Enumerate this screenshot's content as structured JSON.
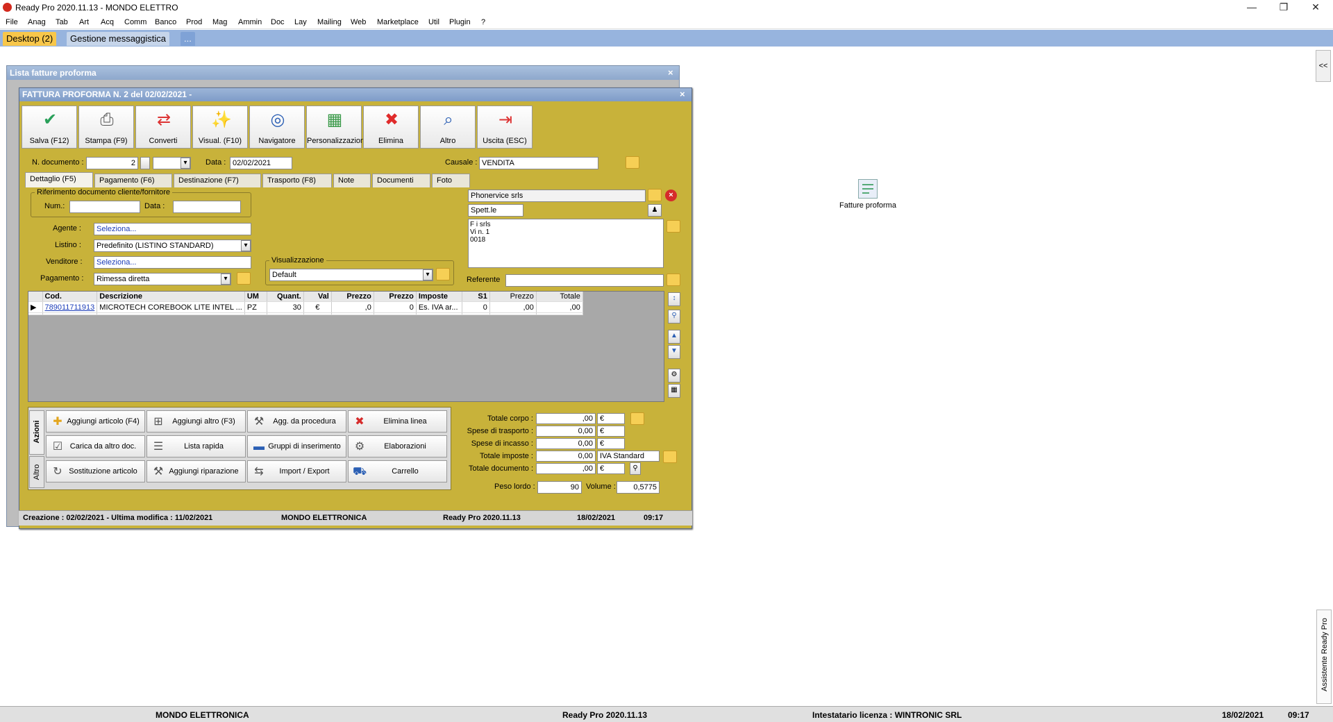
{
  "app": {
    "title": "Ready Pro 2020.11.13 - MONDO ELETTRO"
  },
  "menu": [
    "File",
    "Anag",
    "Tab",
    "Art",
    "Acq",
    "Comm",
    "Banco",
    "Prod",
    "Mag",
    "Ammin",
    "Doc",
    "Lay",
    "Mailing",
    "Web",
    "Marketplace",
    "Util",
    "Plugin",
    "?"
  ],
  "tabs": [
    "Desktop (2)",
    "Gestione messaggistica",
    "..."
  ],
  "outer_window": {
    "title": "Lista fatture proforma"
  },
  "window": {
    "title": "FATTURA PROFORMA N. 2 del 02/02/2021 -"
  },
  "toolbar": [
    {
      "label": "Salva (F12)",
      "icon": "check-icon",
      "color": "#2aa05a"
    },
    {
      "label": "Stampa (F9)",
      "icon": "printer-icon",
      "color": "#555"
    },
    {
      "label": "Converti",
      "icon": "convert-icon",
      "color": "#d33"
    },
    {
      "label": "Visual. (F10)",
      "icon": "wand-icon",
      "color": "#e39b1c"
    },
    {
      "label": "Navigatore",
      "icon": "compass-icon",
      "color": "#2b5fb4"
    },
    {
      "label": "Personalizzazioni",
      "icon": "grid-icon",
      "color": "#3b9a4a"
    },
    {
      "label": "Elimina",
      "icon": "delete-icon",
      "color": "#e02b2b"
    },
    {
      "label": "Altro",
      "icon": "search-doc-icon",
      "color": "#2b5fb4"
    },
    {
      "label": "Uscita (ESC)",
      "icon": "exit-icon",
      "color": "#d33"
    }
  ],
  "header": {
    "ndoc_label": "N. documento :",
    "ndoc": "2",
    "data_label": "Data :",
    "data": "02/02/2021",
    "causale_label": "Causale :",
    "causale": "VENDITA"
  },
  "doc_tabs": [
    "Dettaglio (F5)",
    "Pagamento (F6)",
    "Destinazione (F7)",
    "Trasporto (F8)",
    "Note",
    "Documenti",
    "Foto"
  ],
  "ref": {
    "group": "Riferimento documento cliente/fornitore",
    "num_label": "Num.:",
    "data_label": "Data :"
  },
  "fields": {
    "agente_label": "Agente :",
    "agente": "Seleziona...",
    "listino_label": "Listino :",
    "listino": "Predefinito (LISTINO STANDARD)",
    "venditore_label": "Venditore :",
    "venditore": "Seleziona...",
    "pagamento_label": "Pagamento :",
    "pagamento": "Rimessa diretta",
    "visual_group": "Visualizzazione",
    "visual": "Default",
    "referente_label": "Referente"
  },
  "customer": {
    "name": "Phonervice srls",
    "salutation": "Spett.le",
    "addr1": "F      i srls",
    "addr2": "Vi          n.  1",
    "addr3": "0018"
  },
  "grid": {
    "columns": [
      "Cod.",
      "Descrizione",
      "UM",
      "Quant.",
      "Val",
      "Prezzo",
      "Prezzo",
      "Imposte",
      "S1",
      "Prezzo",
      "Totale"
    ],
    "rows": [
      [
        "789011711913",
        "MICROTECH COREBOOK LITE INTEL ...",
        "PZ",
        "30",
        "€",
        "   ,0",
        "   0",
        "Es. IVA ar...",
        "0",
        "    ,00",
        "    ,00"
      ]
    ]
  },
  "actions_tabs": [
    "Azioni",
    "Altro"
  ],
  "actions": [
    {
      "label": "Aggiungi articolo (F4)",
      "icon": "add-article-icon"
    },
    {
      "label": "Aggiungi altro (F3)",
      "icon": "add-other-icon"
    },
    {
      "label": "Agg. da procedura",
      "icon": "wrench-icon"
    },
    {
      "label": "Elimina linea",
      "icon": "delete-line-icon"
    },
    {
      "label": "Carica da altro doc.",
      "icon": "load-doc-icon"
    },
    {
      "label": "Lista rapida",
      "icon": "quick-list-icon"
    },
    {
      "label": "Gruppi di inserimento",
      "icon": "groups-icon"
    },
    {
      "label": "Elaborazioni",
      "icon": "process-icon"
    },
    {
      "label": "Sostituzione articolo",
      "icon": "replace-icon"
    },
    {
      "label": "Aggiungi riparazione",
      "icon": "repair-icon"
    },
    {
      "label": "Import / Export",
      "icon": "import-export-icon"
    },
    {
      "label": "Carrello",
      "icon": "cart-icon"
    }
  ],
  "totals": [
    {
      "label": "Totale corpo :",
      "value": "    ,00",
      "unit": "€"
    },
    {
      "label": "Spese di trasporto :",
      "value": "0,00",
      "unit": "€"
    },
    {
      "label": "Spese di incasso :",
      "value": "0,00",
      "unit": "€"
    },
    {
      "label": "Totale imposte :",
      "value": "0,00",
      "unit": "IVA Standard"
    },
    {
      "label": "Totale documento :",
      "value": "    ,00",
      "unit": "€"
    }
  ],
  "peso": {
    "label": "Peso lordo :",
    "value": "90",
    "vol_label": "Volume :",
    "vol": "0,5775"
  },
  "status_inner": {
    "created": "Creazione : 02/02/2021 - Ultima modifica : 11/02/2021",
    "company": "MONDO ELETTRONICA",
    "version": "Ready Pro 2020.11.13",
    "date": "18/02/2021",
    "time": "09:17"
  },
  "desktop_icon": {
    "label": "Fatture proforma"
  },
  "sidebar": {
    "collapse": "<<",
    "assistant": "Assistente Ready Pro"
  },
  "status_bottom": {
    "company": "MONDO ELETTRONICA",
    "version": "Ready Pro 2020.11.13",
    "license": "Intestatario licenza : WINTRONIC SRL",
    "date": "18/02/2021",
    "time": "09:17"
  }
}
